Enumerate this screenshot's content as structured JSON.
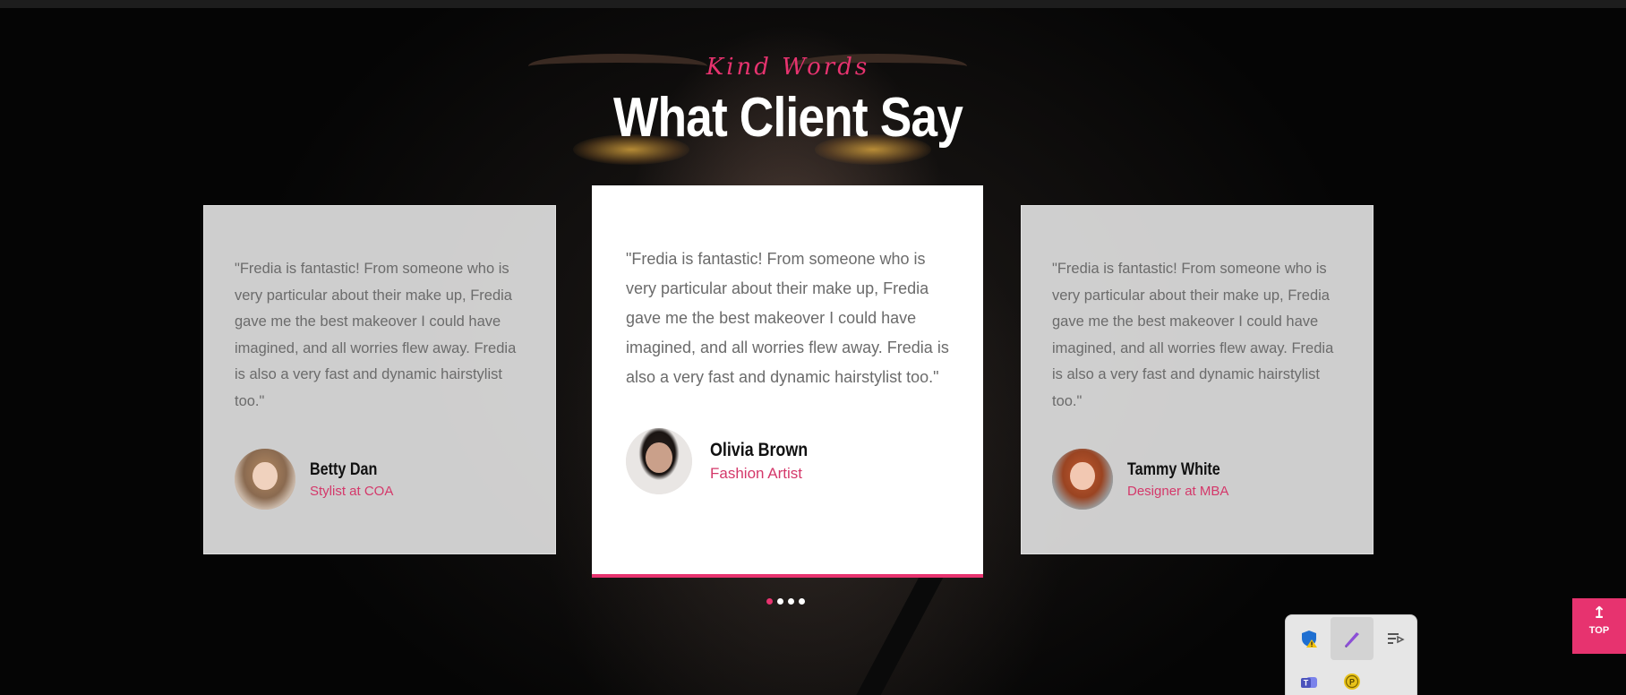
{
  "section": {
    "kicker": "Kind Words",
    "title": "What Client Say"
  },
  "testimonials": [
    {
      "quote": "\"Fredia is fantastic!  From someone who is very particular about their make up,  Fredia gave me the best makeover  I could have imagined, and all worries flew away.  Fredia is also a very fast and dynamic hairstylist too.\"",
      "name": "Betty Dan",
      "role": "Stylist at COA"
    },
    {
      "quote": "\"Fredia is fantastic!  From someone who is very particular about their make up,  Fredia gave me the best makeover  I could have imagined, and all worries flew away.  Fredia is also a very fast and dynamic hairstylist too.\"",
      "name": "Olivia Brown",
      "role": "Fashion Artist"
    },
    {
      "quote": "\"Fredia is fantastic!  From someone who is very particular about their make up,  Fredia gave me the best makeover  I could have imagined, and all worries flew away.  Fredia is also a very fast and dynamic hairstylist too.\"",
      "name": "Tammy White",
      "role": "Designer at  MBA"
    }
  ],
  "carousel": {
    "active_index": 0,
    "dot_count": 4
  },
  "back_to_top": {
    "arrow": "↥",
    "label": "TOP"
  },
  "tray_icons": [
    "shield-warning-icon",
    "pen-icon",
    "chat-flag-icon",
    "teams-icon",
    "badge-p-icon"
  ],
  "colors": {
    "accent": "#e7336f",
    "card_side": "#dedede",
    "card_center": "#ffffff",
    "text_quote": "#6b6b6b",
    "text_role": "#d4386a"
  }
}
